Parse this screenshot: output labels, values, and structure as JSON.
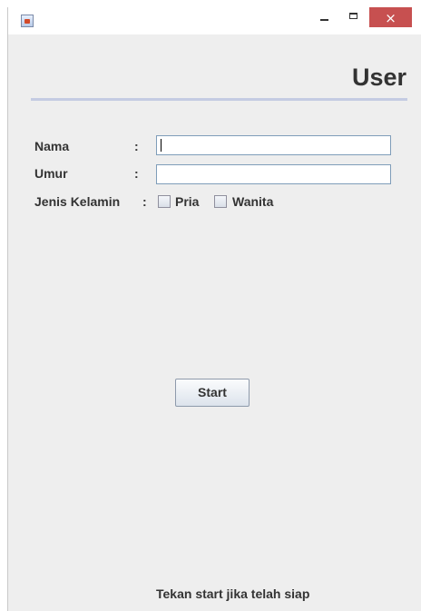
{
  "window": {
    "title": "",
    "app_icon": "java-app-icon",
    "controls": {
      "minimize": "minimize-icon",
      "maximize": "maximize-icon",
      "close": "×"
    }
  },
  "form": {
    "heading": "User",
    "nama_label": "Nama",
    "umur_label": "Umur",
    "gender_label": "Jenis Kelamin",
    "separator": ":",
    "nama_value": "",
    "umur_value": "",
    "gender_options": [
      {
        "label": "Pria",
        "checked": false
      },
      {
        "label": "Wanita",
        "checked": false
      }
    ],
    "start_button": "Start",
    "hint": "Tekan start jika telah siap"
  },
  "colors": {
    "close_button": "#c75050",
    "background": "#eeeeee",
    "heading_rule": "#c4cbe2"
  }
}
